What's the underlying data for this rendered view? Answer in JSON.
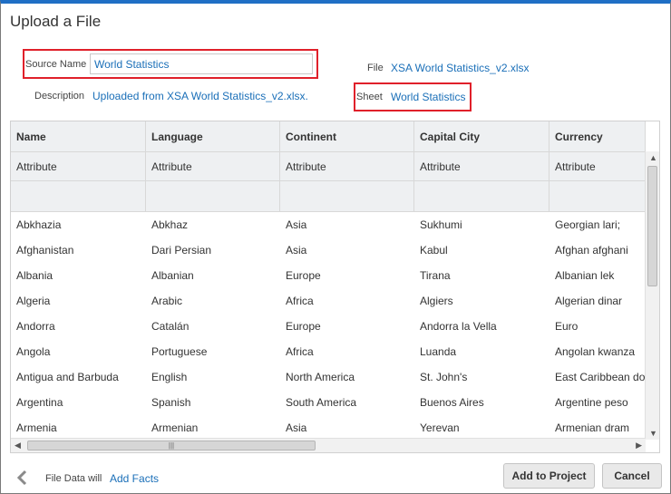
{
  "dialog": {
    "title": "Upload a File",
    "source_name_label": "Source Name",
    "source_name_value": "World Statistics",
    "description_label": "Description",
    "description_value": "Uploaded from XSA World Statistics_v2.xlsx.",
    "file_label": "File",
    "file_value": "XSA World Statistics_v2.xlsx",
    "sheet_label": "Sheet",
    "sheet_value": "World Statistics"
  },
  "table": {
    "columns": [
      "Name",
      "Language",
      "Continent",
      "Capital City",
      "Currency"
    ],
    "types": [
      "Attribute",
      "Attribute",
      "Attribute",
      "Attribute",
      "Attribute"
    ],
    "rows": [
      [
        "Abkhazia",
        "Abkhaz",
        "Asia",
        "Sukhumi",
        "Georgian lari;"
      ],
      [
        "Afghanistan",
        "Dari Persian",
        "Asia",
        "Kabul",
        "Afghan afghani"
      ],
      [
        "Albania",
        "Albanian",
        "Europe",
        "Tirana",
        "Albanian lek"
      ],
      [
        "Algeria",
        "Arabic",
        "Africa",
        "Algiers",
        "Algerian dinar"
      ],
      [
        "Andorra",
        "Catalán",
        "Europe",
        "Andorra la Vella",
        "Euro"
      ],
      [
        "Angola",
        "Portuguese",
        "Africa",
        "Luanda",
        "Angolan kwanza"
      ],
      [
        "Antigua and Barbuda",
        "English",
        "North America",
        "St. John's",
        "East Caribbean do"
      ],
      [
        "Argentina",
        "Spanish",
        "South America",
        "Buenos Aires",
        "Argentine peso"
      ],
      [
        "Armenia",
        "Armenian",
        "Asia",
        "Yerevan",
        "Armenian dram"
      ]
    ]
  },
  "footer": {
    "file_data_will": "File Data will",
    "add_facts": "Add Facts",
    "add_to_project": "Add to Project",
    "cancel": "Cancel"
  }
}
